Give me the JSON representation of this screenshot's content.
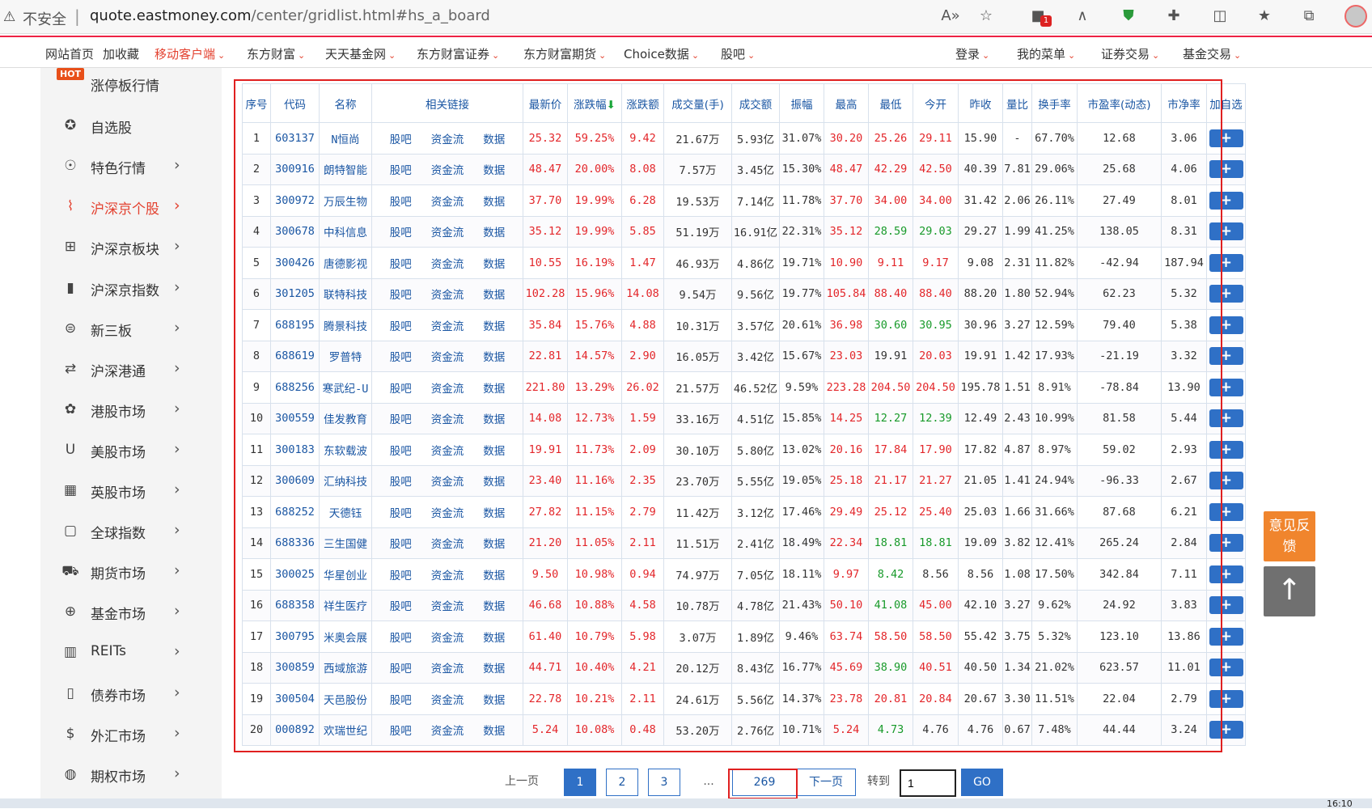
{
  "addressbar": {
    "insecure_label": "不安全",
    "url_host": "quote.eastmoney.com",
    "url_path": "/center/gridlist.html#hs_a_board"
  },
  "topnav": {
    "left": [
      "网站首页",
      "加收藏",
      "移动客户端"
    ],
    "menus": [
      "东方财富",
      "天天基金网",
      "东方财富证券",
      "东方财富期货",
      "Choice数据",
      "股吧"
    ],
    "right": [
      "登录",
      "我的菜单",
      "证券交易",
      "基金交易"
    ]
  },
  "sidebar": {
    "hot_badge": "HOT",
    "items": [
      {
        "label": "涨停板行情",
        "icon": "hot-icon"
      },
      {
        "label": "自选股",
        "icon": "star-circle-icon"
      },
      {
        "label": "特色行情",
        "icon": "person-icon"
      },
      {
        "label": "沪深京个股",
        "icon": "line-chart-icon"
      },
      {
        "label": "沪深京板块",
        "icon": "grid-icon"
      },
      {
        "label": "沪深京指数",
        "icon": "bar-chart-icon"
      },
      {
        "label": "新三板",
        "icon": "three-icon"
      },
      {
        "label": "沪深港通",
        "icon": "exchange-icon"
      },
      {
        "label": "港股市场",
        "icon": "bauhinia-icon"
      },
      {
        "label": "美股市场",
        "icon": "u-icon"
      },
      {
        "label": "英股市场",
        "icon": "uk-flag-icon"
      },
      {
        "label": "全球指数",
        "icon": "bookmark-icon"
      },
      {
        "label": "期货市场",
        "icon": "cart-icon"
      },
      {
        "label": "基金市场",
        "icon": "fund-icon"
      },
      {
        "label": "REITs",
        "icon": "building-icon"
      },
      {
        "label": "债券市场",
        "icon": "doc-icon"
      },
      {
        "label": "外汇市场",
        "icon": "forex-icon"
      },
      {
        "label": "期权市场",
        "icon": "globe-icon"
      }
    ]
  },
  "table": {
    "headers": [
      "序号",
      "代码",
      "名称",
      "相关链接",
      "最新价",
      "涨跌幅",
      "涨跌额",
      "成交量(手)",
      "成交额",
      "振幅",
      "最高",
      "最低",
      "今开",
      "昨收",
      "量比",
      "换手率",
      "市盈率(动态)",
      "市净率",
      "加自选"
    ],
    "links": [
      "股吧",
      "资金流",
      "数据"
    ],
    "add_label": "+",
    "rows": [
      [
        "1",
        "603137",
        "N恒尚",
        "25.32",
        "59.25%",
        "9.42",
        "21.67万",
        "5.93亿",
        "31.07%",
        "30.20",
        "25.26",
        "29.11",
        "15.90",
        "-",
        "67.70%",
        "12.68",
        "3.06"
      ],
      [
        "2",
        "300916",
        "朗特智能",
        "48.47",
        "20.00%",
        "8.08",
        "7.57万",
        "3.45亿",
        "15.30%",
        "48.47",
        "42.29",
        "42.50",
        "40.39",
        "7.81",
        "29.06%",
        "25.68",
        "4.06"
      ],
      [
        "3",
        "300972",
        "万辰生物",
        "37.70",
        "19.99%",
        "6.28",
        "19.53万",
        "7.14亿",
        "11.78%",
        "37.70",
        "34.00",
        "34.00",
        "31.42",
        "2.06",
        "26.11%",
        "27.49",
        "8.01"
      ],
      [
        "4",
        "300678",
        "中科信息",
        "35.12",
        "19.99%",
        "5.85",
        "51.19万",
        "16.91亿",
        "22.31%",
        "35.12",
        "28.59",
        "29.03",
        "29.27",
        "1.99",
        "41.25%",
        "138.05",
        "8.31"
      ],
      [
        "5",
        "300426",
        "唐德影视",
        "10.55",
        "16.19%",
        "1.47",
        "46.93万",
        "4.86亿",
        "19.71%",
        "10.90",
        "9.11",
        "9.17",
        "9.08",
        "2.31",
        "11.82%",
        "-42.94",
        "187.94"
      ],
      [
        "6",
        "301205",
        "联特科技",
        "102.28",
        "15.96%",
        "14.08",
        "9.54万",
        "9.56亿",
        "19.77%",
        "105.84",
        "88.40",
        "88.40",
        "88.20",
        "1.80",
        "52.94%",
        "62.23",
        "5.32"
      ],
      [
        "7",
        "688195",
        "腾景科技",
        "35.84",
        "15.76%",
        "4.88",
        "10.31万",
        "3.57亿",
        "20.61%",
        "36.98",
        "30.60",
        "30.95",
        "30.96",
        "3.27",
        "12.59%",
        "79.40",
        "5.38"
      ],
      [
        "8",
        "688619",
        "罗普特",
        "22.81",
        "14.57%",
        "2.90",
        "16.05万",
        "3.42亿",
        "15.67%",
        "23.03",
        "19.91",
        "20.03",
        "19.91",
        "1.42",
        "17.93%",
        "-21.19",
        "3.32"
      ],
      [
        "9",
        "688256",
        "寒武纪-U",
        "221.80",
        "13.29%",
        "26.02",
        "21.57万",
        "46.52亿",
        "9.59%",
        "223.28",
        "204.50",
        "204.50",
        "195.78",
        "1.51",
        "8.91%",
        "-78.84",
        "13.90"
      ],
      [
        "10",
        "300559",
        "佳发教育",
        "14.08",
        "12.73%",
        "1.59",
        "33.16万",
        "4.51亿",
        "15.85%",
        "14.25",
        "12.27",
        "12.39",
        "12.49",
        "2.43",
        "10.99%",
        "81.58",
        "5.44"
      ],
      [
        "11",
        "300183",
        "东软载波",
        "19.91",
        "11.73%",
        "2.09",
        "30.10万",
        "5.80亿",
        "13.02%",
        "20.16",
        "17.84",
        "17.90",
        "17.82",
        "4.87",
        "8.97%",
        "59.02",
        "2.93"
      ],
      [
        "12",
        "300609",
        "汇纳科技",
        "23.40",
        "11.16%",
        "2.35",
        "23.70万",
        "5.55亿",
        "19.05%",
        "25.18",
        "21.17",
        "21.27",
        "21.05",
        "1.41",
        "24.94%",
        "-96.33",
        "2.67"
      ],
      [
        "13",
        "688252",
        "天德钰",
        "27.82",
        "11.15%",
        "2.79",
        "11.42万",
        "3.12亿",
        "17.46%",
        "29.49",
        "25.12",
        "25.40",
        "25.03",
        "1.66",
        "31.66%",
        "87.68",
        "6.21"
      ],
      [
        "14",
        "688336",
        "三生国健",
        "21.20",
        "11.05%",
        "2.11",
        "11.51万",
        "2.41亿",
        "18.49%",
        "22.34",
        "18.81",
        "18.81",
        "19.09",
        "3.82",
        "12.41%",
        "265.24",
        "2.84"
      ],
      [
        "15",
        "300025",
        "华星创业",
        "9.50",
        "10.98%",
        "0.94",
        "74.97万",
        "7.05亿",
        "18.11%",
        "9.97",
        "8.42",
        "8.56",
        "8.56",
        "1.08",
        "17.50%",
        "342.84",
        "7.11"
      ],
      [
        "16",
        "688358",
        "祥生医疗",
        "46.68",
        "10.88%",
        "4.58",
        "10.78万",
        "4.78亿",
        "21.43%",
        "50.10",
        "41.08",
        "45.00",
        "42.10",
        "3.27",
        "9.62%",
        "24.92",
        "3.83"
      ],
      [
        "17",
        "300795",
        "米奥会展",
        "61.40",
        "10.79%",
        "5.98",
        "3.07万",
        "1.89亿",
        "9.46%",
        "63.74",
        "58.50",
        "58.50",
        "55.42",
        "3.75",
        "5.32%",
        "123.10",
        "13.86"
      ],
      [
        "18",
        "300859",
        "西域旅游",
        "44.71",
        "10.40%",
        "4.21",
        "20.12万",
        "8.43亿",
        "16.77%",
        "45.69",
        "38.90",
        "40.51",
        "40.50",
        "1.34",
        "21.02%",
        "623.57",
        "11.01"
      ],
      [
        "19",
        "300504",
        "天邑股份",
        "22.78",
        "10.21%",
        "2.11",
        "24.61万",
        "5.56亿",
        "14.37%",
        "23.78",
        "20.81",
        "20.84",
        "20.67",
        "3.30",
        "11.51%",
        "22.04",
        "2.79"
      ],
      [
        "20",
        "000892",
        "欢瑞世纪",
        "5.24",
        "10.08%",
        "0.48",
        "53.20万",
        "2.76亿",
        "10.71%",
        "5.24",
        "4.73",
        "4.76",
        "4.76",
        "0.67",
        "7.48%",
        "44.44",
        "3.24"
      ]
    ]
  },
  "pager": {
    "prev": "上一页",
    "pages": [
      "1",
      "2",
      "3"
    ],
    "ellipsis": "...",
    "last": "269",
    "next": "下一页",
    "goto_label": "转到",
    "goto_value": "1",
    "go": "GO"
  },
  "float": {
    "feedback": "意见反馈",
    "top": "↑"
  },
  "clock": "16:10",
  "colors": {
    "up": "#e3262a",
    "down": "#189a2a",
    "link": "#1a56a3",
    "accent": "#e3412f"
  }
}
